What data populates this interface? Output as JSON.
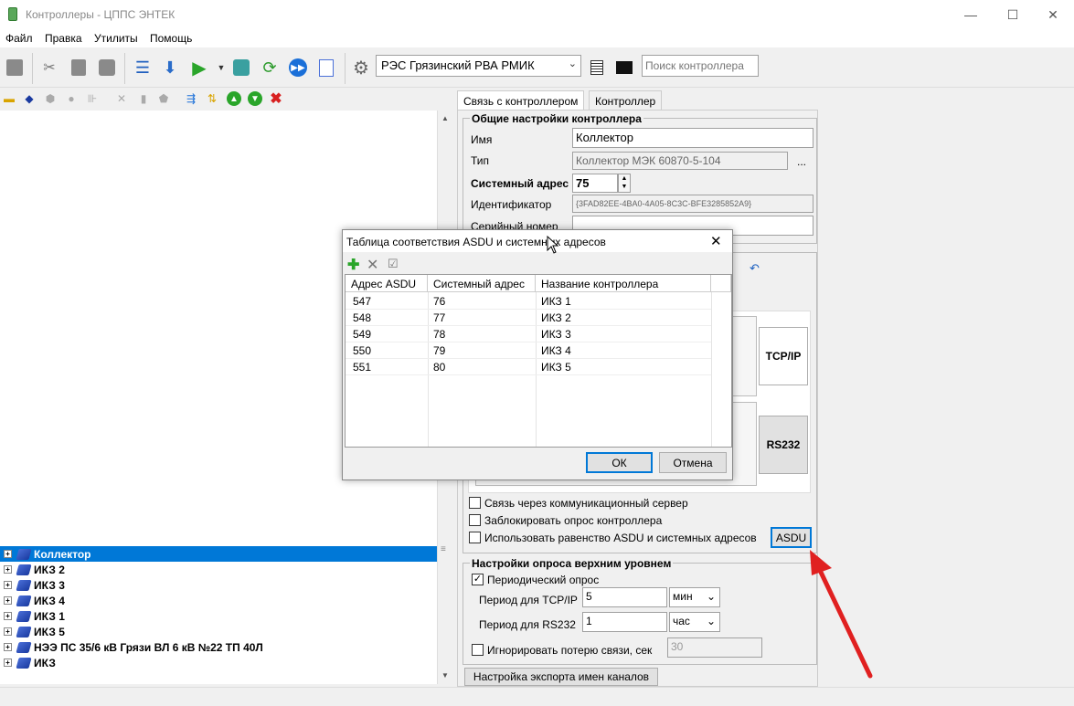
{
  "window": {
    "title": "Контроллеры - ЦППС ЭНТЕК",
    "minimize": "—",
    "maximize": "☐",
    "close": "✕"
  },
  "menu": [
    "Файл",
    "Правка",
    "Утилиты",
    "Помощь"
  ],
  "toolbar": {
    "controller_select": "РЭС Грязинский РВА РМИК",
    "search_placeholder": "Поиск контроллера"
  },
  "tree": {
    "items": [
      {
        "label": "Коллектор",
        "selected": true
      },
      {
        "label": "ИКЗ 2"
      },
      {
        "label": "ИКЗ 3"
      },
      {
        "label": "ИКЗ 4"
      },
      {
        "label": "ИКЗ 1"
      },
      {
        "label": "ИКЗ 5"
      },
      {
        "label": "НЭЭ ПС 35/6 кВ Грязи ВЛ 6 кВ №22 ТП 40Л"
      },
      {
        "label": "ИКЗ"
      }
    ]
  },
  "tabs": [
    "Связь с контроллером",
    "Контроллер"
  ],
  "general": {
    "group_title": "Общие настройки контроллера",
    "name_label": "Имя",
    "name_value": "Коллектор",
    "type_label": "Тип",
    "type_value": "Коллектор МЭК 60870-5-104",
    "type_button": "...",
    "sysaddr_label": "Системный адрес",
    "sysaddr_value": "75",
    "id_label": "Идентификатор",
    "id_value": "{3FAD82EE-4BA0-4A05-8C3C-BFE3285852A9}",
    "serial_label": "Серийный номер",
    "serial_value": ""
  },
  "conn": {
    "tcpip": "TCP/IP",
    "rs232": "RS232"
  },
  "options": {
    "comm_server": "Связь через коммуникационный сервер",
    "block_poll": "Заблокировать опрос контроллера",
    "asdu_equal": "Использовать равенство ASDU и системных адресов",
    "asdu_button": "ASDU"
  },
  "upper": {
    "group_title": "Настройки опроса верхним уровнем",
    "periodic": "Периодический опрос",
    "periodic_checked": "✓",
    "tcp_label": "Период для TCP/IP",
    "tcp_value": "5",
    "tcp_unit": "мин",
    "rs_label": "Период для RS232",
    "rs_value": "1",
    "rs_unit": "час",
    "ignore_label": "Игнорировать потерю связи, сек",
    "ignore_value": "30"
  },
  "export_button": "Настройка экспорта имен каналов",
  "dialog": {
    "title": "Таблица соответствия ASDU и системных адресов",
    "columns": [
      "Адрес ASDU",
      "Системный адрес",
      "Название контроллера"
    ],
    "rows": [
      [
        "547",
        "76",
        "ИКЗ 1"
      ],
      [
        "548",
        "77",
        "ИКЗ 2"
      ],
      [
        "549",
        "78",
        "ИКЗ 3"
      ],
      [
        "550",
        "79",
        "ИКЗ 4"
      ],
      [
        "551",
        "80",
        "ИКЗ 5"
      ]
    ],
    "ok": "ОК",
    "cancel": "Отмена",
    "close": "✕"
  },
  "colors": {
    "accent": "#0078d7",
    "arrow": "#e02020"
  }
}
